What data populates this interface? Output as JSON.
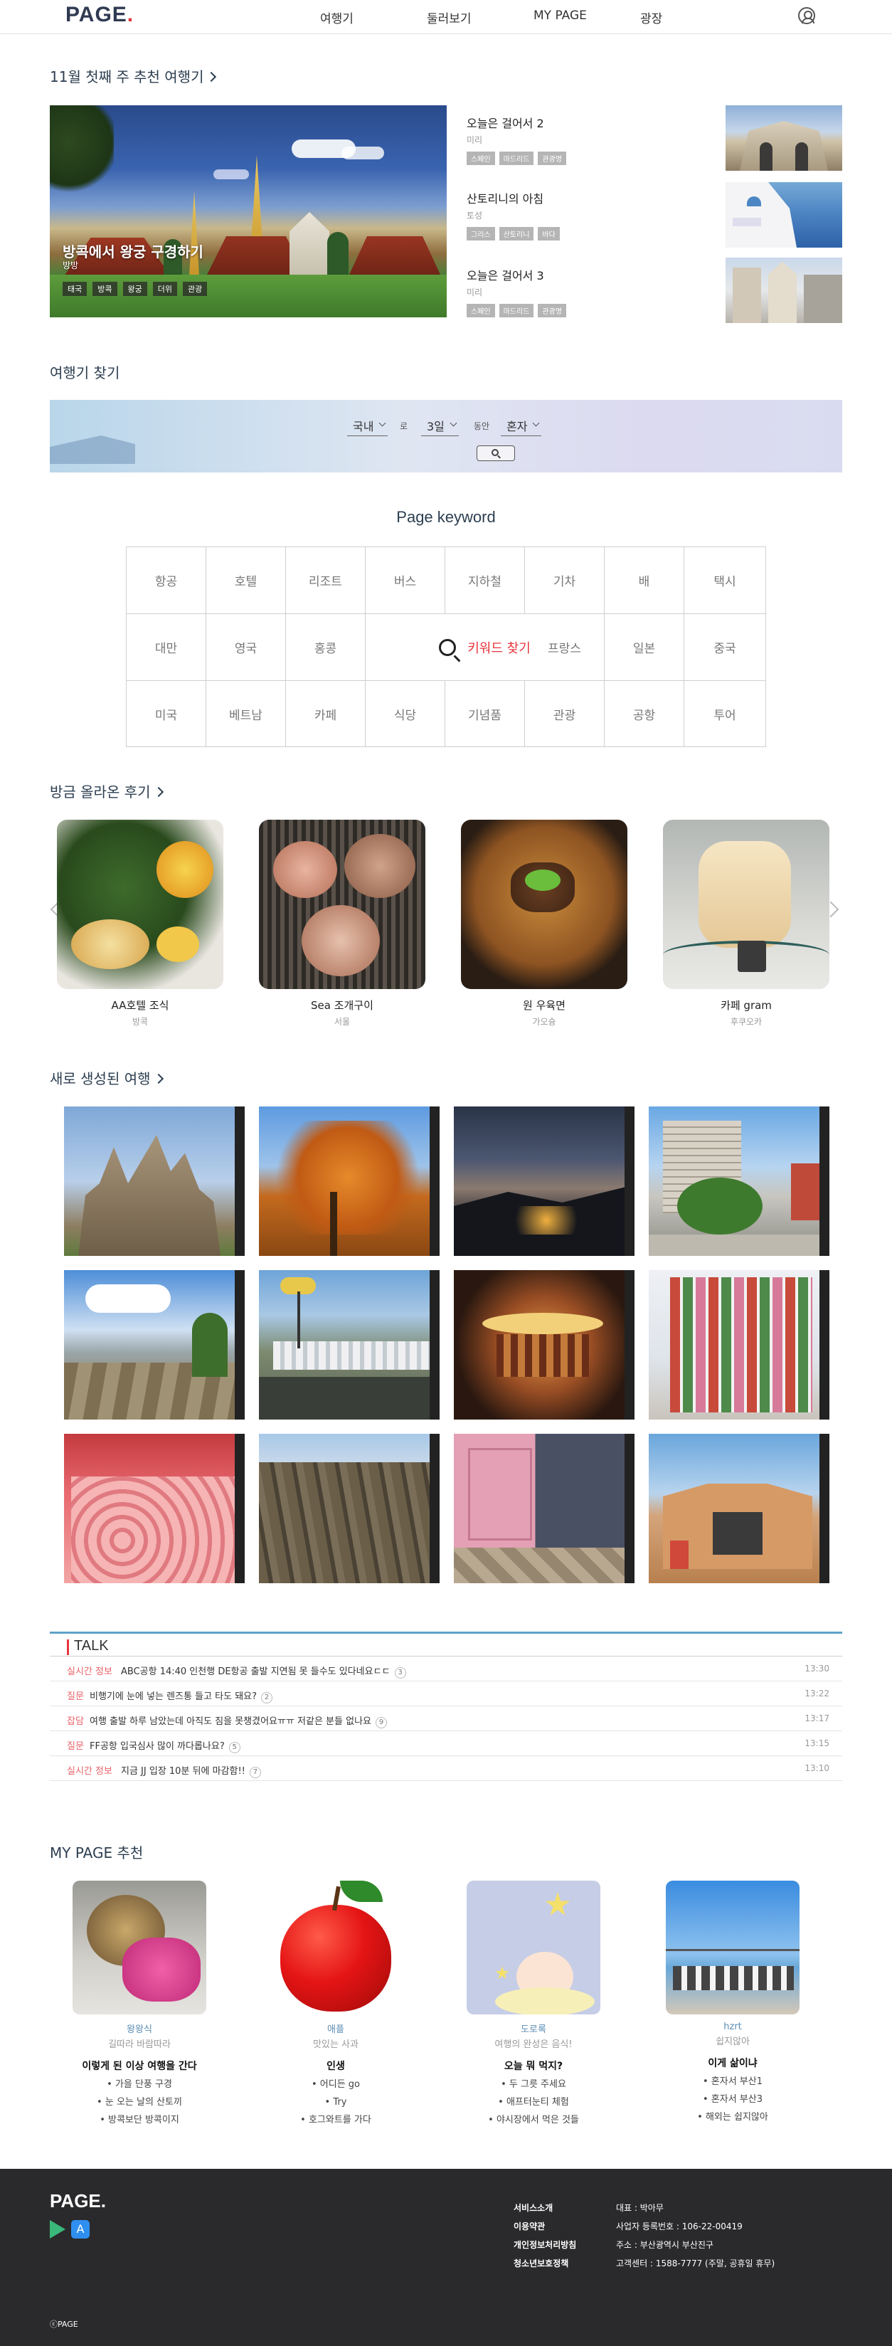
{
  "header": {
    "logo": "PAGE",
    "logo_dot": ".",
    "nav": [
      "여행기",
      "둘러보기",
      "MY PAGE",
      "광장"
    ],
    "user_icon": "user-circle-icon"
  },
  "recommend": {
    "heading": "11월 첫째 주 추천 여행기",
    "feature": {
      "title": "방콕에서 왕궁 구경하기",
      "author": "방방",
      "tags": [
        "태국",
        "방콕",
        "왕궁",
        "더위",
        "관광"
      ]
    },
    "items": [
      {
        "title": "오늘은 걸어서 2",
        "author": "미리",
        "tags": [
          "스페인",
          "마드리드",
          "관광명"
        ]
      },
      {
        "title": "산토리니의 아침",
        "author": "토성",
        "tags": [
          "그리스",
          "산토리니",
          "바다"
        ]
      },
      {
        "title": "오늘은 걸어서 3",
        "author": "미리",
        "tags": [
          "스페인",
          "마드리드",
          "관광명"
        ]
      }
    ]
  },
  "search": {
    "heading": "여행기 찾기",
    "region": "국내",
    "region_suffix": "로",
    "days": "3일",
    "days_suffix": "동안",
    "companion": "혼자",
    "button_icon": "search-icon"
  },
  "keyword": {
    "heading": "Page keyword",
    "row1": [
      "항공",
      "호텔",
      "리조트",
      "버스",
      "지하철",
      "기차",
      "배",
      "택시"
    ],
    "row2_left": [
      "대만",
      "영국",
      "홍콩"
    ],
    "center": "키워드 찾기",
    "row2_right": [
      "프랑스",
      "일본",
      "중국"
    ],
    "row3": [
      "미국",
      "베트남",
      "카페",
      "식당",
      "기념품",
      "관광",
      "공항",
      "투어"
    ]
  },
  "reviews": {
    "heading": "방금 올라온 후기",
    "items": [
      {
        "name": "AA호텔 조식",
        "location": "방콕"
      },
      {
        "name": "Sea 조개구이",
        "location": "서울"
      },
      {
        "name": "원 우육면",
        "location": "가오슝"
      },
      {
        "name": "카페 gram",
        "location": "후쿠오카"
      }
    ]
  },
  "new_trips": {
    "heading": "새로 생성된 여행"
  },
  "talk": {
    "heading": "TALK",
    "rows": [
      {
        "category": "실시간 정보",
        "text": "ABC공항 14:40 인천행 DE항공 출발 지연됨 못 들수도 있다네요ㄷㄷ",
        "count": "3",
        "time": "13:30"
      },
      {
        "category": "질문",
        "text": "비행기에 눈에 넣는 렌즈통 들고 타도 돼요?",
        "count": "2",
        "time": "13:22"
      },
      {
        "category": "잡담",
        "text": "여행 출발 하루 남았는데 아직도 짐을 못챙겼어요ㅠㅠ 저같은 분들 없나요",
        "count": "9",
        "time": "13:17"
      },
      {
        "category": "질문",
        "text": "FF공항 입국심사 많이 까다롭나요?",
        "count": "5",
        "time": "13:15"
      },
      {
        "category": "실시간 정보",
        "text": "지금 JJ 입장 10분 뒤에 마감함!!",
        "count": "7",
        "time": "13:10"
      }
    ]
  },
  "mypage": {
    "heading": "MY PAGE 추천",
    "cards": [
      {
        "user": "왕왕식",
        "desc": "길따라 바람따라",
        "title": "이렇게 된 이상 여행을 간다",
        "items": [
          "가을 단풍 구경",
          "눈 오는 날의 산토끼",
          "방콕보단 방콕이지"
        ]
      },
      {
        "user": "애플",
        "desc": "맛있는 사과",
        "title": "인생",
        "items": [
          "어디든 go",
          "Try",
          "호그와트를 가다"
        ]
      },
      {
        "user": "도로록",
        "desc": "여행의 완성은 음식!",
        "title": "오늘 뭐 먹지?",
        "items": [
          "두 그릇 주세요",
          "애프터눈티 체험",
          "야시장에서 먹은 것들"
        ]
      },
      {
        "user": "hzrt",
        "desc": "쉽지않아",
        "title": "이게 삶이냐",
        "items": [
          "혼자서 부산1",
          "혼자서 부산3",
          "해외는 쉽지않아"
        ]
      }
    ]
  },
  "footer": {
    "logo": "PAGE.",
    "links": [
      "서비스소개",
      "이용약관",
      "개인정보처리방침",
      "청소년보호정책"
    ],
    "info": [
      "대표 : 박아무",
      "사업자 등록번호 : 106-22-00419",
      "주소 : 부산광역시 부산진구",
      "고객센터 : 1588-7777 (주말, 공휴일 휴무)"
    ],
    "copyright": "ⓒPAGE",
    "store_icons": [
      "google-play-icon",
      "app-store-icon"
    ]
  },
  "colors": {
    "accent": "#e8343c",
    "navy": "#2c3e50",
    "talk_line": "#5fa2c8",
    "footer_bg": "#2a2a2c"
  }
}
